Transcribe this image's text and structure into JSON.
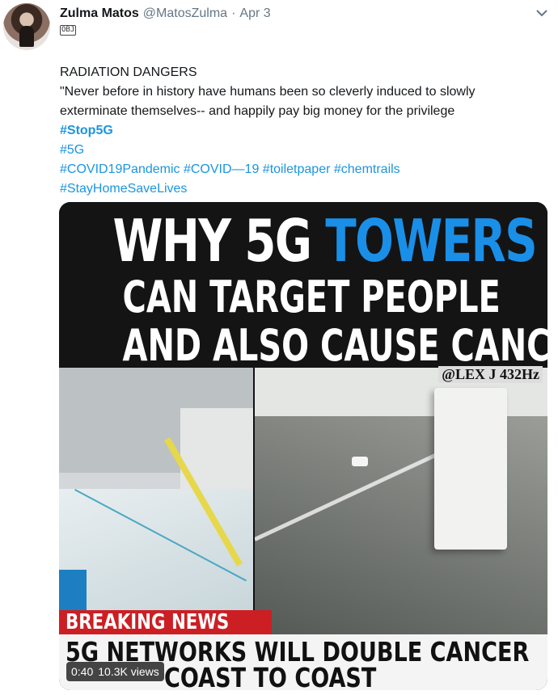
{
  "tweet": {
    "author_name": "Zulma Matos",
    "handle": "@MatosZulma",
    "separator": "·",
    "date": "Apr 3",
    "emoji_label": "OBJ",
    "lines": {
      "title": "RADIATION DANGERS",
      "quote1": "\"Never before in history have humans been so cleverly induced to slowly",
      "quote2": "exterminate themselves-- and happily pay big money for the privilege"
    },
    "hashtags": {
      "stop5g": "#Stop5G",
      "h5g": "#5G",
      "covid_pandemic": "#COVID19Pandemic",
      "covid19": "#COVID—19",
      "toiletpaper": "#toiletpaper",
      "chemtrails": "#chemtrails",
      "stayhome": "#StayHomeSaveLives"
    }
  },
  "media": {
    "headline": {
      "line1_white": "WHY 5G ",
      "line1_blue": "TOWERS",
      "line2": "CAN TARGET PEOPLE",
      "line3": "AND ALSO CAUSE CANCER"
    },
    "watermark": "@LEX J 432Hz",
    "breaking_label": "BREAKING NEWS",
    "ticker_line1": "5G NETWORKS WILL DOUBLE CANCER",
    "ticker_line2": "COAST TO COAST",
    "video_time": "0:40",
    "video_views": "10.3K views"
  },
  "colors": {
    "link": "#1b95e0",
    "headline_blue": "#1a8fe8",
    "breaking_red": "#cc1f24"
  },
  "icons": {
    "chevron": "chevron-down-icon"
  }
}
